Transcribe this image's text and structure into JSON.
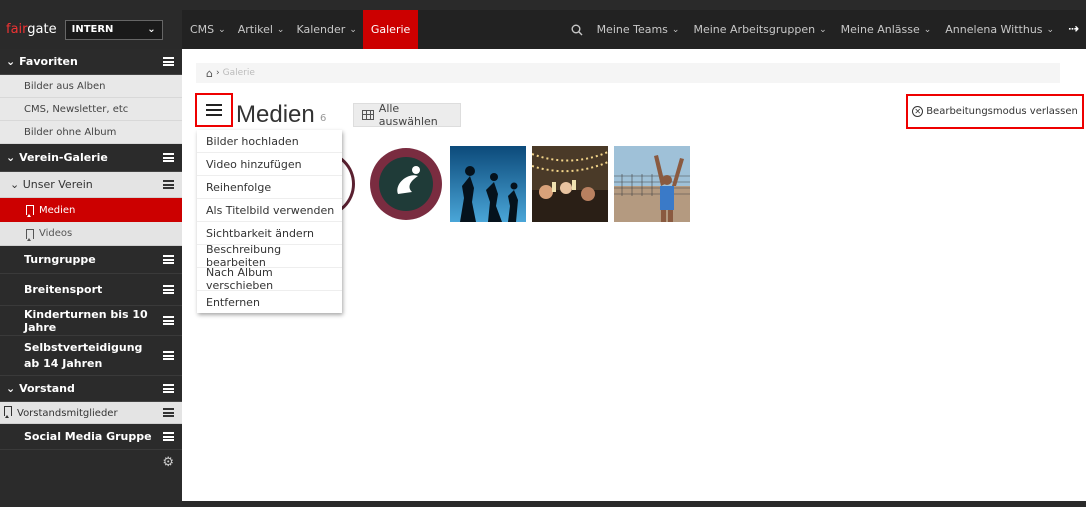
{
  "header": {
    "brand_prefix": "fair",
    "brand_suffix": "gate",
    "org_select": "INTERN",
    "nav": [
      {
        "label": "CMS"
      },
      {
        "label": "Artikel"
      },
      {
        "label": "Kalender"
      },
      {
        "label": "Galerie",
        "active": true
      }
    ],
    "right_nav": [
      {
        "label": "Meine Teams"
      },
      {
        "label": "Meine Arbeitsgruppen"
      },
      {
        "label": "Meine Anlässe"
      },
      {
        "label": "Annelena Witthus"
      }
    ]
  },
  "sidebar": {
    "favoriten": {
      "title": "Favoriten",
      "items": [
        "Bilder aus Alben",
        "CMS, Newsletter, etc",
        "Bilder ohne Album"
      ]
    },
    "verein_galerie": "Verein-Galerie",
    "unser_verein": {
      "title": "Unser Verein",
      "items": [
        "Medien",
        "Videos"
      ]
    },
    "groups": [
      "Turngruppe",
      "Breitensport",
      "Kinderturnen bis 10 Jahre",
      "Selbstverteidigung ab 14 Jahren"
    ],
    "vorstand": {
      "title": "Vorstand",
      "items": [
        "Vorstandsmitglieder"
      ]
    },
    "social": "Social Media Gruppe"
  },
  "main": {
    "breadcrumb": "Galerie",
    "title": "Medien",
    "count": "6",
    "select_all": "Alle auswählen",
    "exit_edit": "Bearbeitungsmodus verlassen",
    "menu": [
      "Bilder hochladen",
      "Video hinzufügen",
      "Reihenfolge",
      "Als Titelbild verwenden",
      "Sichtbarkeit ändern",
      "Beschreibung bearbeiten",
      "Nach Album verschieben",
      "Entfernen"
    ],
    "thumbnails": [
      "logo-dark",
      "club-logo",
      "runners-silhouette",
      "party-crowd",
      "volleyball-player"
    ]
  },
  "colors": {
    "accent": "#cc0000",
    "dark": "#2b2b2b",
    "highlight": "#e00000"
  }
}
